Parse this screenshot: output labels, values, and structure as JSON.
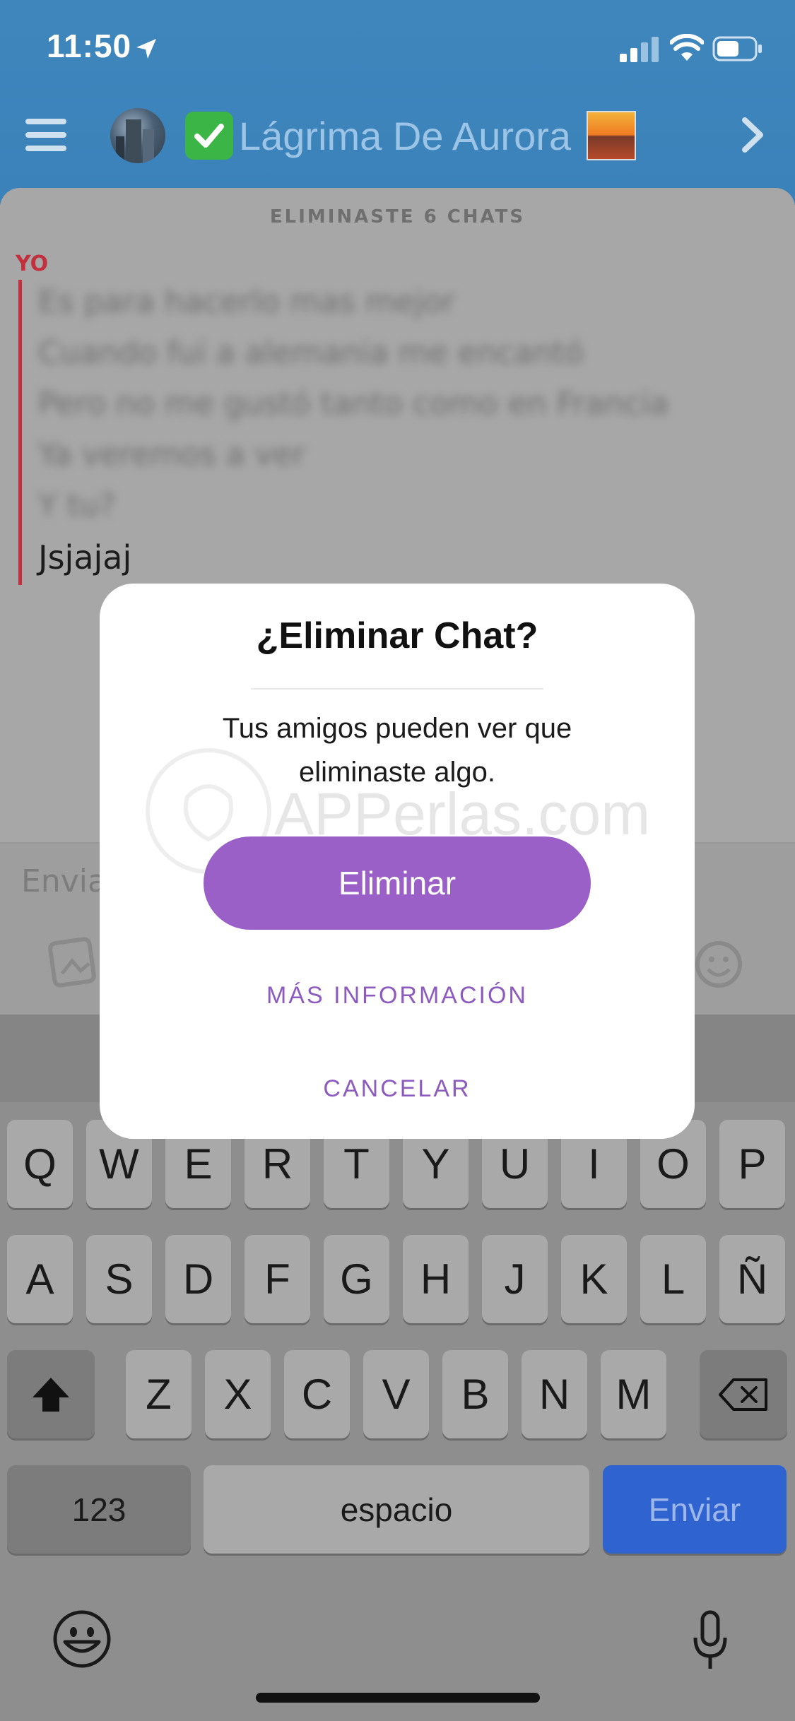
{
  "status_bar": {
    "time": "11:50"
  },
  "header": {
    "title": "Lágrima De Aurora"
  },
  "chat": {
    "deleted_note": "ELIMINASTE 6 CHATS",
    "sender_label": "YO",
    "messages": [
      "Es para hacerlo mas mejor",
      "Cuando fui a alemania me encantó",
      "Pero no me gustó tanto como en Francia",
      "Ya veremos a ver",
      "Y tu?",
      "Jsjajaj"
    ],
    "input_placeholder": "Envia"
  },
  "dialog": {
    "title": "¿Eliminar Chat?",
    "message_line1": "Tus amigos pueden ver que",
    "message_line2": "eliminaste algo.",
    "delete_label": "Eliminar",
    "more_info_label": "MÁS INFORMACIÓN",
    "cancel_label": "CANCELAR"
  },
  "watermark": {
    "text": "APPerlas.com"
  },
  "keyboard": {
    "row1": [
      "Q",
      "W",
      "E",
      "R",
      "T",
      "Y",
      "U",
      "I",
      "O",
      "P"
    ],
    "row2": [
      "A",
      "S",
      "D",
      "F",
      "G",
      "H",
      "J",
      "K",
      "L",
      "Ñ"
    ],
    "row3": [
      "Z",
      "X",
      "C",
      "V",
      "B",
      "N",
      "M"
    ],
    "numbers_label": "123",
    "space_label": "espacio",
    "send_label": "Enviar"
  },
  "colors": {
    "header": "#3f86bd",
    "accent_purple": "#9b60c8",
    "sender_red": "#c3303d",
    "send_blue": "#2f63cf"
  }
}
